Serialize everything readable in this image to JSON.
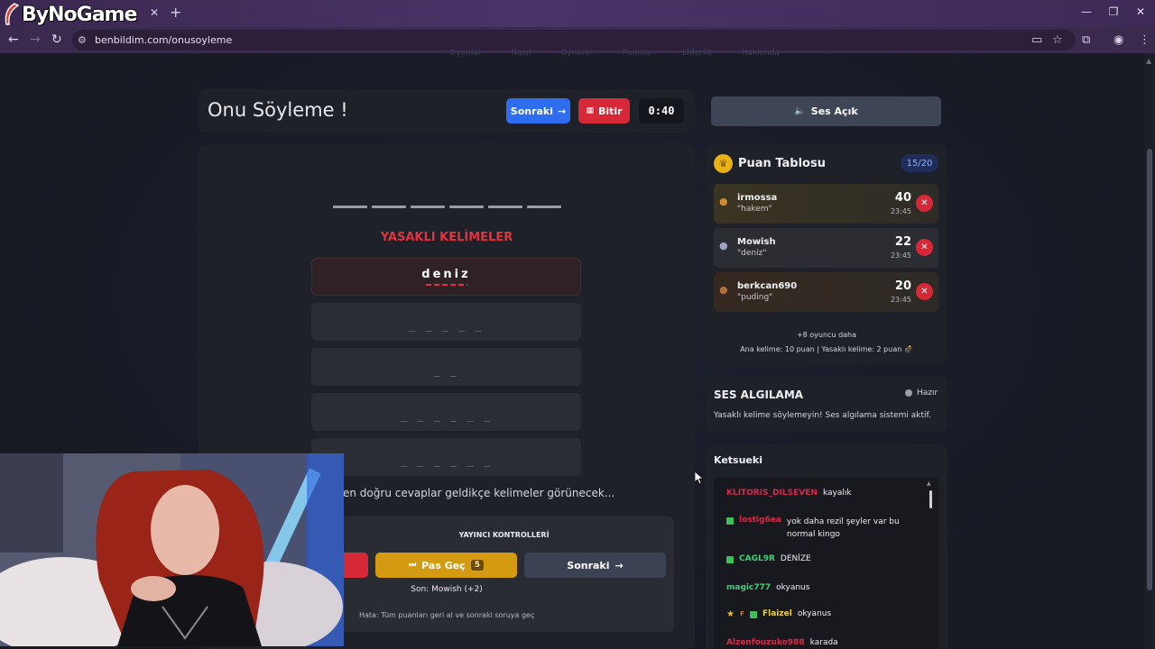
{
  "browser": {
    "brand": "ByNoGame",
    "url": "benbildim.com/onusoyleme"
  },
  "nav_ghost": "Oyunlar Nasıl Oynanır Puanlar Liderlik Hakkında",
  "game": {
    "title": "Onu Söyleme !",
    "next_label": "Sonraki",
    "finish_label": "Bitir",
    "timer": "0:40",
    "forbidden_title": "YASAKLI KELİMELER",
    "forbidden": [
      {
        "text": "deniz",
        "revealed": true
      },
      {
        "text": "_ _ _ _ _",
        "revealed": false
      },
      {
        "text": "_ _",
        "revealed": false
      },
      {
        "text": "_ _ _ _ _ _",
        "revealed": false
      },
      {
        "text": "_ _ _ _ _ _",
        "revealed": false
      }
    ],
    "hint": "en doğru cevaplar geldikçe kelimeler görünecek...",
    "controls": {
      "title": "YAYINCI KONTROLLERİ",
      "pass_label": "Pas Geç",
      "pass_count": "5",
      "next_label": "Sonraki",
      "last": "Son: Mowish (+2)",
      "tip": "Hata: Tüm puanları geri al ve sonraki soruya geç"
    }
  },
  "sound": {
    "label": "Ses Açık"
  },
  "leaderboard": {
    "title": "Puan Tablosu",
    "count": "15/20",
    "players": [
      {
        "name": "irmossa",
        "guess": "\"hakem\"",
        "score": "40",
        "time": "23:45",
        "medal_color": "#d08a30"
      },
      {
        "name": "Mowish",
        "guess": "\"deniz\"",
        "score": "22",
        "time": "23:45",
        "medal_color": "#9aa4c8"
      },
      {
        "name": "berkcan690",
        "guess": "\"puding\"",
        "score": "20",
        "time": "23:45",
        "medal_color": "#b0703a"
      }
    ],
    "more": "+8 oyuncu daha",
    "scoring": "Ana kelime: 10 puan | Yasaklı kelime: 2 puan 💣"
  },
  "voice": {
    "title": "SES ALGILAMA",
    "status": "Hazır",
    "desc": "Yasaklı kelime söylemeyin! Ses algılama sistemi aktif."
  },
  "chat": {
    "title": "Ketsueki",
    "messages": [
      {
        "user": "KLITORIS_DILSEVEN",
        "text": "kayalık",
        "color": "#d8284a",
        "badges": []
      },
      {
        "user": "lostig6ea",
        "text": "yok daha rezil şeyler var bu normal kingo",
        "color": "#d8284a",
        "badges": [
          "green"
        ]
      },
      {
        "user": "CAGL9R",
        "text": "DENİZE",
        "color": "#3fd07a",
        "badges": [
          "green"
        ]
      },
      {
        "user": "magic777",
        "text": "okyanus",
        "color": "#3fd07a",
        "badges": []
      },
      {
        "user": "Flaizel",
        "text": "okyanus",
        "color": "#f0d040",
        "badges": [
          "star",
          "r",
          "green"
        ]
      },
      {
        "user": "Alzenfouzuko988",
        "text": "karada",
        "color": "#d8284a",
        "badges": []
      }
    ]
  },
  "colors": {
    "accent_blue": "#2f6df0",
    "accent_red": "#d72837",
    "accent_gold": "#d39a12",
    "forbidden_red": "#e0323f"
  }
}
